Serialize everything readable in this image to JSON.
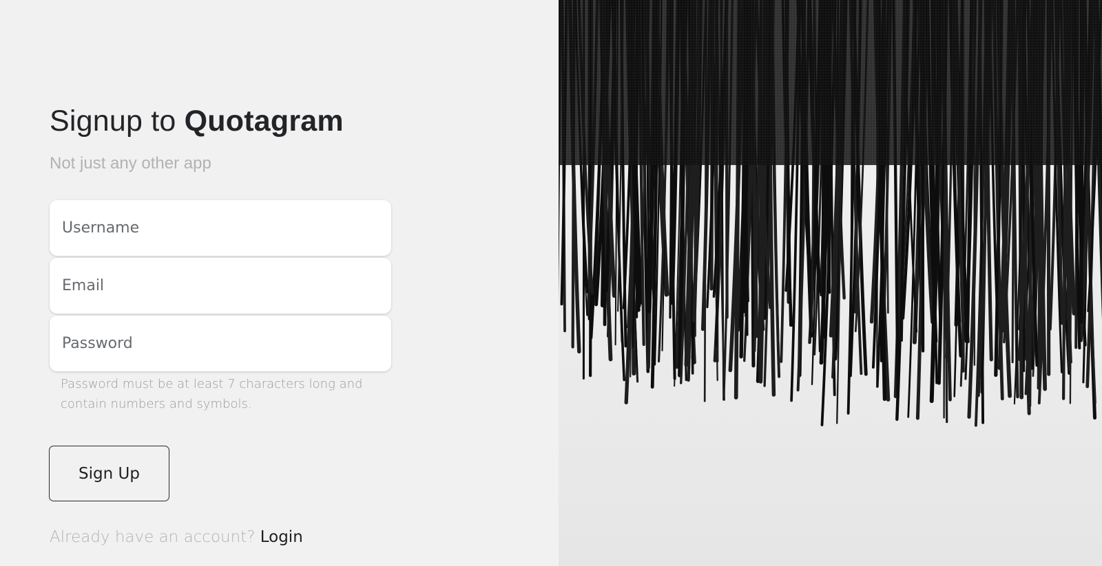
{
  "heading": {
    "prefix": "Signup to ",
    "brand": "Quotagram"
  },
  "subtitle": "Not just any other app",
  "form": {
    "username_placeholder": "Username",
    "email_placeholder": "Email",
    "password_placeholder": "Password",
    "password_hint": "Password must be at least 7 characters long and contain numbers and symbols.",
    "submit_label": "Sign Up"
  },
  "footer": {
    "prompt": "Already have an account?",
    "login_label": "Login"
  },
  "hero": {
    "description_icon": "black-fringe-photo"
  },
  "colors": {
    "background": "#f1f1f1",
    "text_dark": "#232427",
    "text_muted": "#b2b2b2"
  }
}
